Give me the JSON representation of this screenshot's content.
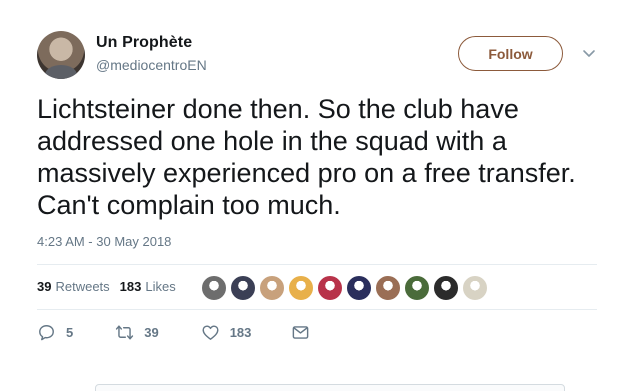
{
  "tweet": {
    "display_name": "Un Prophète",
    "handle": "@mediocentroEN",
    "follow_label": "Follow",
    "text_lines": [
      "Lichtsteiner done then. So the club have",
      "addressed one hole in the squad with a",
      "massively experienced pro on a free transfer.",
      "Can't complain too much."
    ],
    "timestamp": "4:23 AM - 30 May 2018"
  },
  "stats": {
    "retweets_count": "39",
    "retweets_label": "Retweets",
    "likes_count": "183",
    "likes_label": "Likes"
  },
  "liker_avatars": [
    {
      "color": "#6d6d6d",
      "icon": "avatar-photo"
    },
    {
      "color": "#3b3f55",
      "icon": "avatar-photo"
    },
    {
      "color": "#c8a17c",
      "icon": "avatar-photo"
    },
    {
      "color": "#e8b04a",
      "icon": "avatar-photo"
    },
    {
      "color": "#b8334a",
      "icon": "avatar-photo"
    },
    {
      "color": "#2a2e5c",
      "icon": "avatar-photo"
    },
    {
      "color": "#9a6e55",
      "icon": "avatar-photo"
    },
    {
      "color": "#4a6b3a",
      "icon": "avatar-photo"
    },
    {
      "color": "#2b2b2b",
      "icon": "avatar-photo"
    },
    {
      "color": "#d8d3c4",
      "icon": "avatar-photo"
    }
  ],
  "actions": {
    "reply_count": "5",
    "retweet_count": "39",
    "like_count": "183"
  },
  "colors": {
    "accent": "#8c5a3b",
    "secondary_text": "#657786",
    "divider": "#e6ecf0"
  }
}
